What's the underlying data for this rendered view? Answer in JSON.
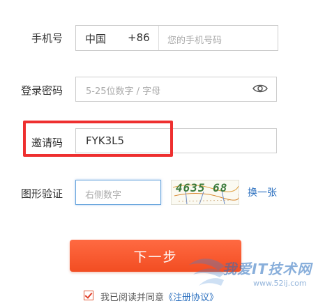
{
  "phone": {
    "label": "手机号",
    "country": "中国",
    "code": "+86",
    "placeholder": "您的手机号码"
  },
  "password": {
    "label": "登录密码",
    "placeholder": "5-25位数字 / 字母",
    "toggle_icon": "eye-icon"
  },
  "invite": {
    "label": "邀请码",
    "value": "FYK3L5",
    "highlight_color": "#ee2f2f"
  },
  "captcha": {
    "label": "图形验证",
    "placeholder": "右侧数字",
    "image_text": "4635 68",
    "refresh_label": "换一张"
  },
  "next_button": {
    "label": "下一步",
    "color": "#f4562b"
  },
  "agreement": {
    "checked": true,
    "prefix": "我已阅读并同意",
    "link": "《注册协议》"
  },
  "watermark": {
    "text": "我爱IT技术网",
    "url": "www.52ij.com"
  },
  "colors": {
    "accent": "#f4562b",
    "link": "#2a6fbf"
  }
}
